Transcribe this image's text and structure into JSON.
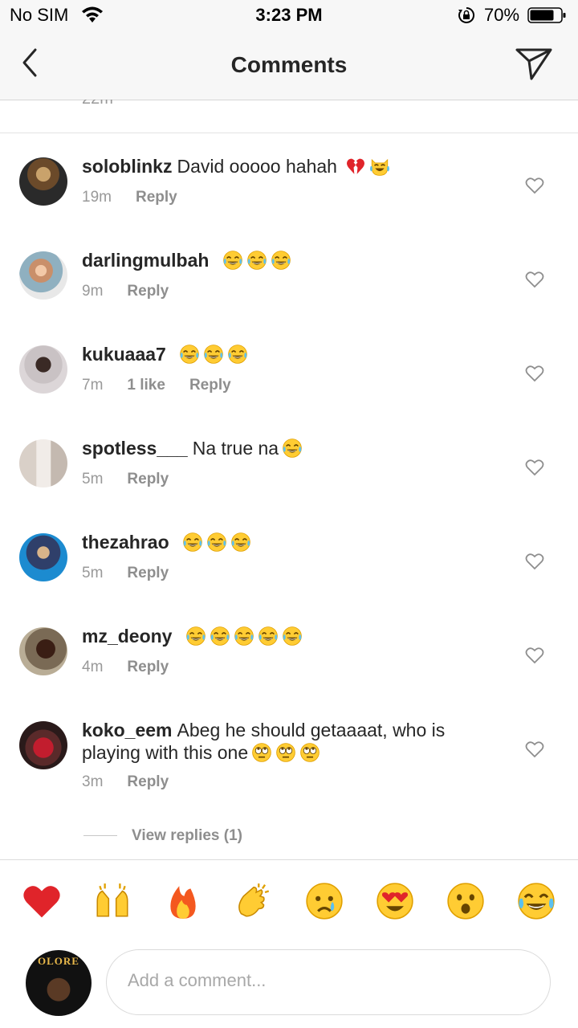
{
  "status_bar": {
    "carrier": "No SIM",
    "time": "3:23 PM",
    "battery_percent": "70%"
  },
  "navbar": {
    "title": "Comments",
    "back_icon": "chevron-left-icon",
    "send_icon": "paper-plane-icon"
  },
  "partial_timestamp": "22m",
  "comments": [
    {
      "username": "soloblinkz",
      "text": "David ooooo hahah",
      "emojis": [
        "broken-heart",
        "cat-tears-of-joy"
      ],
      "time": "19m",
      "likes": "",
      "reply": "Reply"
    },
    {
      "username": "darlingmulbah",
      "text": "",
      "emojis": [
        "tears-of-joy",
        "tears-of-joy",
        "tears-of-joy"
      ],
      "time": "9m",
      "likes": "",
      "reply": "Reply"
    },
    {
      "username": "kukuaaa7",
      "text": "",
      "emojis": [
        "tears-of-joy",
        "tears-of-joy",
        "tears-of-joy"
      ],
      "time": "7m",
      "likes": "1 like",
      "reply": "Reply"
    },
    {
      "username": "spotless___",
      "text": "Na true na",
      "emojis": [
        "tears-of-joy"
      ],
      "time": "5m",
      "likes": "",
      "reply": "Reply"
    },
    {
      "username": "thezahrao",
      "text": "",
      "emojis": [
        "tears-of-joy",
        "tears-of-joy",
        "tears-of-joy"
      ],
      "time": "5m",
      "likes": "",
      "reply": "Reply"
    },
    {
      "username": "mz_deony",
      "text": "",
      "emojis": [
        "tears-of-joy",
        "tears-of-joy",
        "tears-of-joy",
        "tears-of-joy",
        "tears-of-joy"
      ],
      "time": "4m",
      "likes": "",
      "reply": "Reply"
    },
    {
      "username": "koko_eem",
      "text": "Abeg he should getaaaat, who is playing with this one",
      "emojis": [
        "rolling-eyes",
        "rolling-eyes",
        "rolling-eyes"
      ],
      "time": "3m",
      "likes": "",
      "reply": "Reply"
    }
  ],
  "view_replies": "View replies (1)",
  "quick_emojis": [
    "red-heart",
    "raising-hands",
    "fire",
    "clapping-hands",
    "crying-face",
    "heart-eyes",
    "astonished-face",
    "tears-of-joy"
  ],
  "compose": {
    "placeholder": "Add a comment...",
    "avatar_text": "OLORE"
  },
  "colors": {
    "text": "#262626",
    "secondary": "#8e8e8e",
    "separator": "#dbdbdb",
    "bar_background": "#f7f7f7"
  }
}
